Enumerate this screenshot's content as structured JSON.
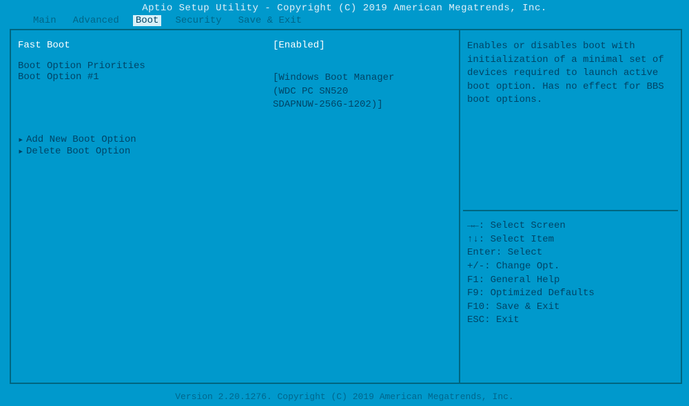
{
  "title": "Aptio Setup Utility - Copyright (C) 2019 American Megatrends, Inc.",
  "footer": "Version 2.20.1276. Copyright (C) 2019 American Megatrends, Inc.",
  "tabs": {
    "main": "Main",
    "advanced": "Advanced",
    "boot": "Boot",
    "security": "Security",
    "save_exit": "Save & Exit"
  },
  "left": {
    "fast_boot_label": "Fast Boot",
    "fast_boot_value": "[Enabled]",
    "priorities_header": "Boot Option Priorities",
    "option1_label": "Boot Option #1",
    "option1_value_l1": "[Windows Boot Manager",
    "option1_value_l2": "(WDC PC SN520",
    "option1_value_l3": "SDAPNUW-256G-1202)]",
    "add_new": "Add New Boot Option",
    "delete": "Delete Boot Option"
  },
  "help_text": "Enables or disables boot with initialization of a minimal set of devices required to launch active boot option. Has no effect for BBS boot options.",
  "keys": {
    "k1": "→←: Select Screen",
    "k2": "↑↓: Select Item",
    "k3": "Enter: Select",
    "k4": "+/-: Change Opt.",
    "k5": "F1: General Help",
    "k6": "F9: Optimized Defaults",
    "k7": "F10: Save & Exit",
    "k8": "ESC: Exit"
  }
}
